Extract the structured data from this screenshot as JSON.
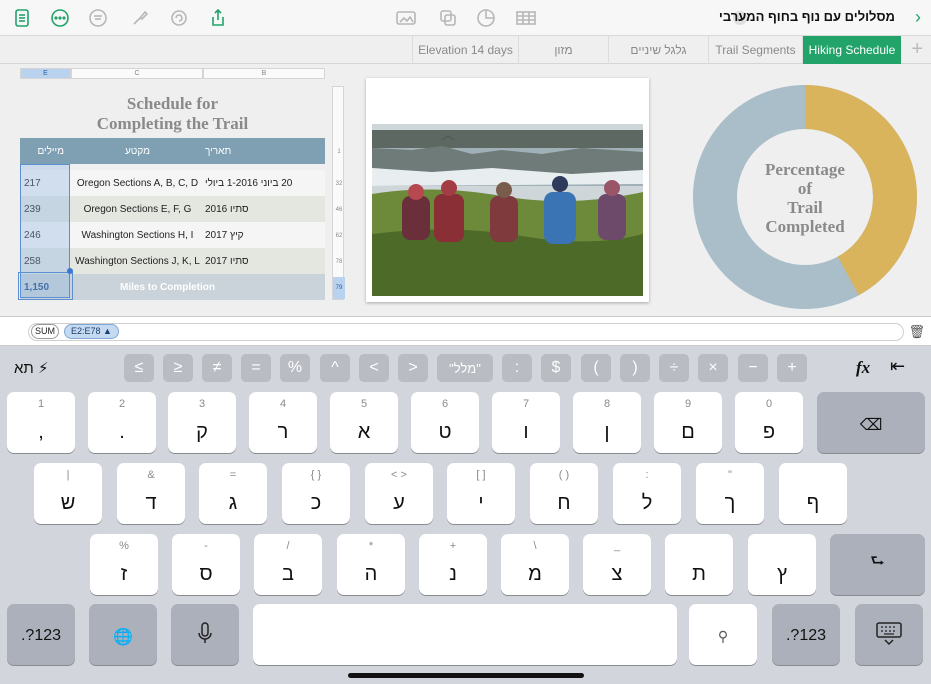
{
  "doc": {
    "title": "מסלולים עם נוף בחוף המערבי"
  },
  "tabs": [
    {
      "label": "Hiking Schedule",
      "active": true
    },
    {
      "label": "Trail Segments",
      "active": false
    },
    {
      "label": "גלגל שיניים",
      "active": false
    },
    {
      "label": "מזון",
      "active": false
    },
    {
      "label": "Elevation 14 days",
      "active": false
    }
  ],
  "table": {
    "title_line1": "Schedule for",
    "title_line2": "Completing the Trail",
    "col_letters": [
      "E",
      "C",
      "B"
    ],
    "headers": {
      "miles": "מיילים",
      "section": "מקטע",
      "date": "תאריך"
    },
    "rows": [
      {
        "miles": "217",
        "section": "Oregon Sections A, B, C, D",
        "date": "20 ביוני 1-2016 ביולי"
      },
      {
        "miles": "239",
        "section": "Oregon Sections E, F, G",
        "date": "סתיו 2016"
      },
      {
        "miles": "246",
        "section": "Washington Sections H, I",
        "date": "קיץ 2017"
      },
      {
        "miles": "258",
        "section": "Washington Sections J, K, L",
        "date": "סתיו 2017"
      }
    ],
    "total": {
      "miles": "1,150",
      "label": "Miles to Completion"
    },
    "row_numbers": [
      "1",
      "32",
      "46",
      "62",
      "78",
      "79"
    ]
  },
  "donut": {
    "label_lines": [
      "Percentage",
      "of",
      "Trail",
      "Completed"
    ],
    "completed_fraction": 0.42,
    "colors": {
      "completed": "#d9b45c",
      "remaining": "#a9bec9"
    }
  },
  "formula": {
    "func": "SUM",
    "ref": "E2:E78 ▲"
  },
  "keyboard": {
    "top_left": "תא",
    "math_keys": [
      "≤",
      "≥",
      "≠",
      "=",
      "%",
      "^",
      "<",
      ">",
      "\"מלל\"",
      ":",
      "$",
      "(",
      ")",
      "÷",
      "×",
      "−",
      "+"
    ],
    "fx": "fx",
    "row1": [
      {
        "top": "1",
        "bot": ","
      },
      {
        "top": "2",
        "bot": "."
      },
      {
        "top": "3",
        "bot": "ק"
      },
      {
        "top": "4",
        "bot": "ר"
      },
      {
        "top": "5",
        "bot": "א"
      },
      {
        "top": "6",
        "bot": "ט"
      },
      {
        "top": "7",
        "bot": "ו"
      },
      {
        "top": "8",
        "bot": "ן"
      },
      {
        "top": "9",
        "bot": "ם"
      },
      {
        "top": "0",
        "bot": "פ"
      }
    ],
    "row2": [
      {
        "top": "|",
        "bot": "ש"
      },
      {
        "top": "&",
        "bot": "ד"
      },
      {
        "top": "=",
        "bot": "ג"
      },
      {
        "top": "{     }",
        "bot": "כ"
      },
      {
        "top": "<     >",
        "bot": "ע"
      },
      {
        "top": "[     ]",
        "bot": "י"
      },
      {
        "top": "(     )",
        "bot": "ח"
      },
      {
        "top": ":",
        "bot": "ל"
      },
      {
        "top": "\"",
        "bot": "ך"
      },
      {
        "top": "",
        "bot": "ף"
      }
    ],
    "row3": [
      {
        "top": "%",
        "bot": "ז"
      },
      {
        "top": "-",
        "bot": "ס"
      },
      {
        "top": "/",
        "bot": "ב"
      },
      {
        "top": "*",
        "bot": "ה"
      },
      {
        "top": "+",
        "bot": "נ"
      },
      {
        "top": "\\",
        "bot": "מ"
      },
      {
        "top": "_",
        "bot": "צ"
      },
      {
        "top": "",
        "bot": "ת"
      },
      {
        "top": "",
        "bot": "ץ"
      }
    ],
    "num_label": ".?123"
  }
}
